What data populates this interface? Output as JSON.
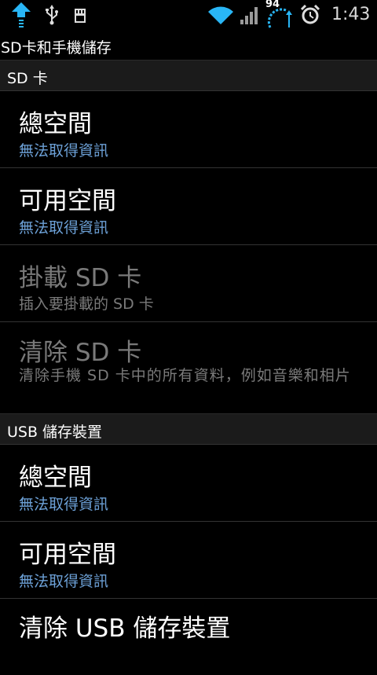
{
  "status_bar": {
    "battery_level": "94",
    "time": "1:43",
    "icons": [
      "upload-arrow-icon",
      "usb-icon",
      "sd-card-icon",
      "wifi-icon",
      "signal-icon",
      "battery-icon",
      "alarm-icon"
    ]
  },
  "title": "SD卡和手機儲存",
  "sections": [
    {
      "label": "SD 卡",
      "items": [
        {
          "title": "總空間",
          "summary": "無法取得資訊"
        },
        {
          "title": "可用空間",
          "summary": "無法取得資訊"
        },
        {
          "title": "掛載 SD 卡",
          "summary": "插入要掛載的 SD 卡"
        },
        {
          "title": "清除 SD 卡",
          "summary": "清除手機 SD 卡中的所有資料，例如音樂和相片"
        }
      ]
    },
    {
      "label": "USB 儲存裝置",
      "items": [
        {
          "title": "總空間",
          "summary": "無法取得資訊"
        },
        {
          "title": "可用空間",
          "summary": "無法取得資訊"
        },
        {
          "title": "清除 USB 儲存裝置"
        }
      ]
    }
  ],
  "colors": {
    "background": "#000000",
    "category_background": "#1b1b1b",
    "summary_blue": "#6ca0d6",
    "disabled_gray": "#7a7a7a",
    "status_accent": "#29b6f6"
  }
}
